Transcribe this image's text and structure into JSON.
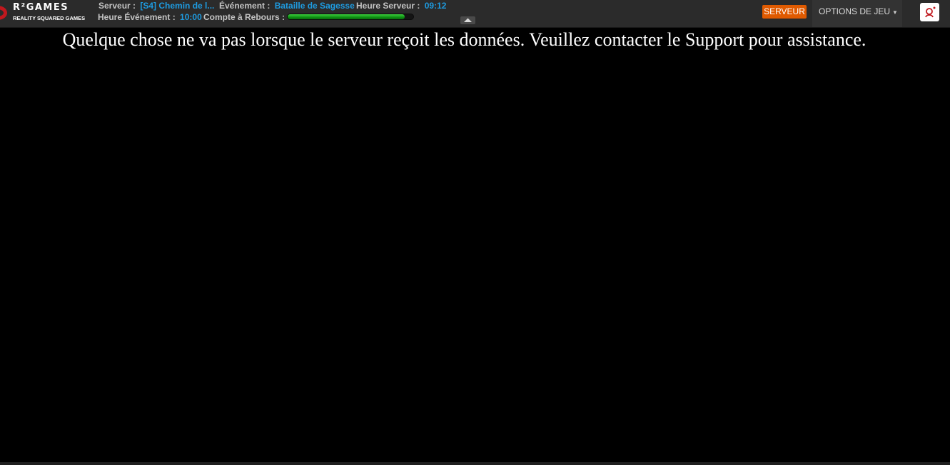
{
  "logo": {
    "title": "R²GAMES",
    "subtitle": "REALITY SQUARED GAMES"
  },
  "server": {
    "label": "Serveur :",
    "value": "[S4] Chemin de l..."
  },
  "event": {
    "label": "Événement :",
    "value": "Bataille de Sagesse"
  },
  "server_time": {
    "label": "Heure Serveur :",
    "value": "09:12"
  },
  "event_time": {
    "label": "Heure Événement :",
    "value": "10:00"
  },
  "countdown": {
    "label": "Compte à Rebours :",
    "progress": 0.93
  },
  "actions": {
    "server_button": "SERVEUR",
    "options_menu": "OPTIONS DE JEU"
  },
  "icons": {
    "logo": "r2-logo-icon",
    "collapse": "chevron-up-icon",
    "account": "user-account-icon",
    "dropdown": "caret-down-icon"
  },
  "colors": {
    "topbar": "#2b2b2b",
    "accent": "#1e9be0",
    "server_button": "#e05a00",
    "progress": "#1aa31f"
  },
  "error_message": "Quelque chose ne va pas lorsque le serveur reçoit les données. Veuillez contacter le Support pour assistance."
}
